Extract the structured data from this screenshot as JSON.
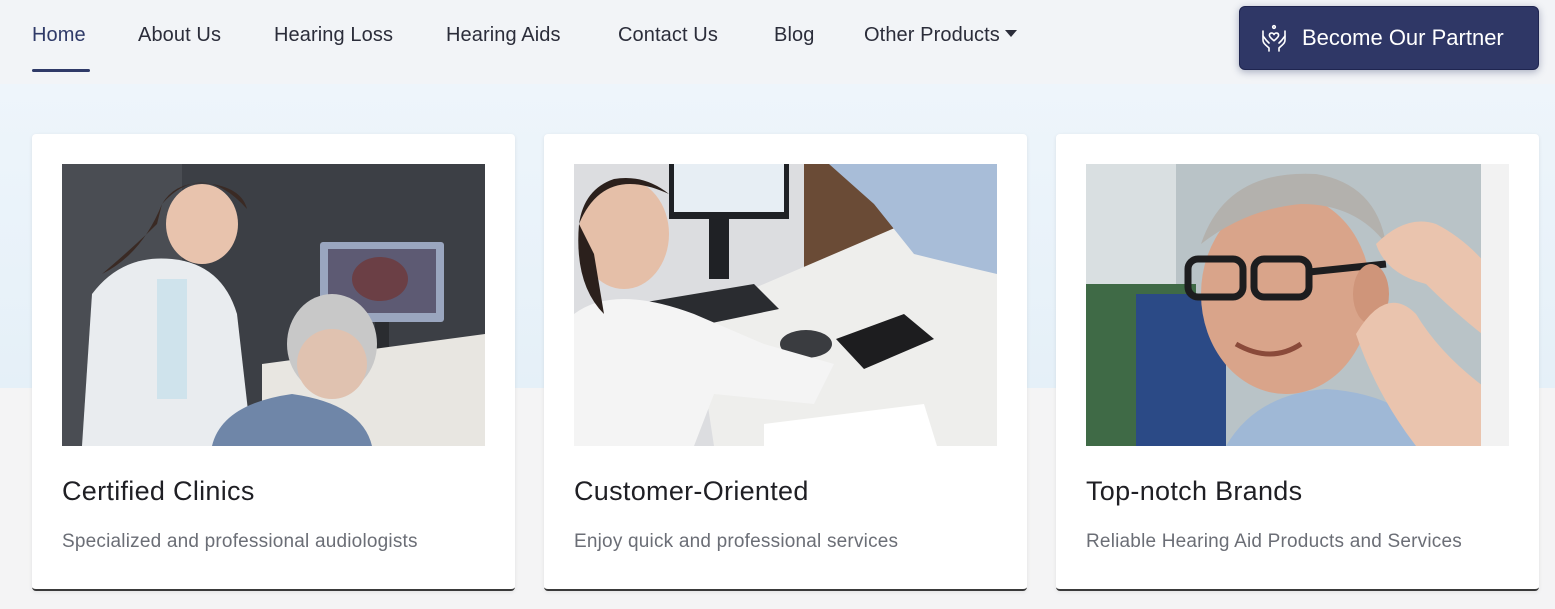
{
  "nav": {
    "items": [
      {
        "label": "Home"
      },
      {
        "label": "About Us"
      },
      {
        "label": "Hearing Loss"
      },
      {
        "label": "Hearing Aids"
      },
      {
        "label": "Contact Us"
      },
      {
        "label": "Blog"
      },
      {
        "label": "Other Products"
      }
    ],
    "active": "Home",
    "partner_button": {
      "label": "Become Our Partner",
      "icon": "hands-heart-icon"
    }
  },
  "cards": [
    {
      "image": "audiologist-examining-ear-photo",
      "title": "Certified Clinics",
      "description": "Specialized and professional audiologists"
    },
    {
      "image": "doctor-showing-hearing-aid-photo",
      "title": "Customer-Oriented",
      "description": "Enjoy quick and professional services"
    },
    {
      "image": "man-fitted-with-hearing-aid-photo",
      "title": "Top-notch Brands",
      "description": "Reliable Hearing Aid Products and Services"
    }
  ],
  "colors": {
    "accent": "#2f3766",
    "text": "#2b2d3a",
    "muted": "#6b6e76"
  }
}
